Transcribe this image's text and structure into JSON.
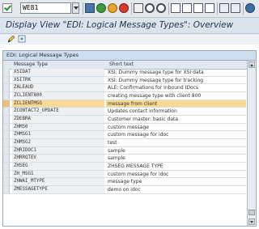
{
  "toolbar": {
    "command_value": "WE81",
    "icons": [
      "check-icon",
      "save-icon",
      "back-icon",
      "exit-icon",
      "cancel-icon",
      "print-icon",
      "find-icon",
      "find-next-icon",
      "first-page-icon",
      "previous-page-icon",
      "next-page-icon",
      "last-page-icon",
      "create-session-icon",
      "shortcut-icon",
      "help-icon"
    ]
  },
  "title": "Display View \"EDI: Logical Message Types\": Overview",
  "app_toolbar": {
    "icons": [
      "display-change-icon",
      "refresh-icon"
    ]
  },
  "table": {
    "panel_title": "EDI: Logical Message Types",
    "col_message_type": "Message Type",
    "col_short_text": "Short text",
    "rows": [
      {
        "type": "XSIDAT",
        "text": "XSI: Dummy message type for XSI data"
      },
      {
        "type": "XSITRK",
        "text": "XSI: Dummy message type for tracking"
      },
      {
        "type": "ZALEAUD",
        "text": "ALE: Confirmations for Inbound IDocs"
      },
      {
        "type": "ZCLIENT800",
        "text": "creating message type with client 800"
      },
      {
        "type": "ZCLIENTMSG",
        "text": "message from client"
      },
      {
        "type": "ZCONTACT2_UPDATE",
        "text": "Updates contact information"
      },
      {
        "type": "ZDEBRA",
        "text": "Customer master: basic data"
      },
      {
        "type": "ZHMS0",
        "text": "custom message"
      },
      {
        "type": "ZHMSG1",
        "text": "custom message for idoc"
      },
      {
        "type": "ZHMSG2",
        "text": "test"
      },
      {
        "type": "ZHRIDOC1",
        "text": "sample"
      },
      {
        "type": "ZHRRQTEV",
        "text": "sample"
      },
      {
        "type": "ZHSEG",
        "text": "ZHSEG MESSAGE TYPE"
      },
      {
        "type": "ZH_MSG1",
        "text": "custom message for idoc"
      },
      {
        "type": "ZHWAI_MTYPE",
        "text": "message type"
      },
      {
        "type": "ZMESSAGETYPE",
        "text": "demo on idoc"
      }
    ],
    "highlighted_row": "ZCLIENTMSG"
  }
}
